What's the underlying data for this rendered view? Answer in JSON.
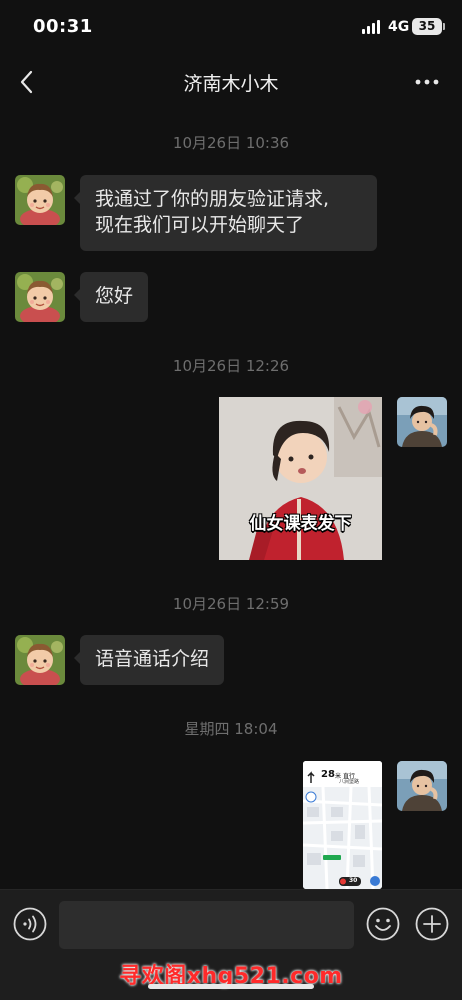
{
  "status_bar": {
    "time": "00:31",
    "network": "4G",
    "battery": "35"
  },
  "nav": {
    "title": "济南木小木"
  },
  "messages": {
    "ts1": "10月26日 10:36",
    "m1_line1": "我通过了你的朋友验证请求,",
    "m1_line2": "现在我们可以开始聊天了",
    "m2": "您好",
    "ts2": "10月26日 12:26",
    "sticker_caption": "仙女课表发下",
    "ts3": "10月26日 12:59",
    "m3": "语音通话介绍",
    "ts4": "星期四 18:04",
    "nav_shot": {
      "distance": "28",
      "distance_unit": "米",
      "action": "直行",
      "road": "八涧堡路",
      "speed": "30"
    }
  },
  "input": {
    "placeholder": ""
  },
  "watermark": "寻欢阁xhg521.com",
  "colors": {
    "background": "#111111",
    "bubble": "#2c2c2c",
    "timestamp": "#6e6e6e",
    "watermark": "#ff2a2a"
  }
}
